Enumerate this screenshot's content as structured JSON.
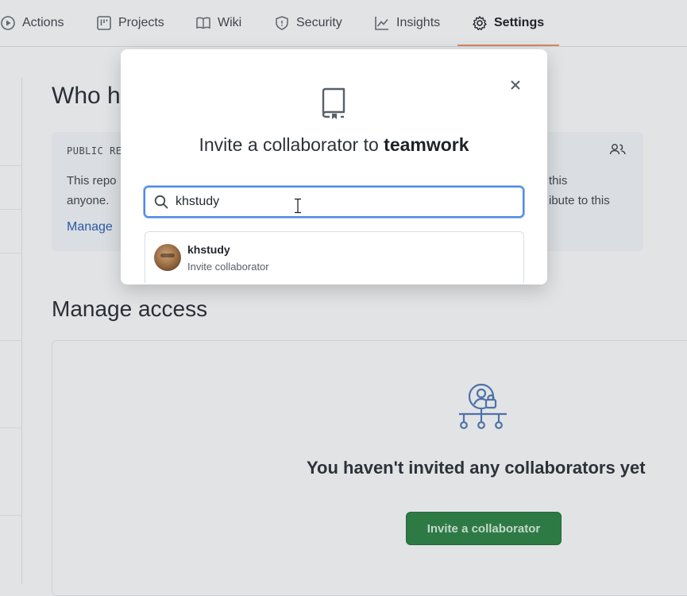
{
  "nav": {
    "tabs": [
      {
        "label": "Actions",
        "icon": "play-circle-icon"
      },
      {
        "label": "Projects",
        "icon": "project-board-icon"
      },
      {
        "label": "Wiki",
        "icon": "book-icon"
      },
      {
        "label": "Security",
        "icon": "shield-icon"
      },
      {
        "label": "Insights",
        "icon": "graph-icon"
      },
      {
        "label": "Settings",
        "icon": "gear-icon",
        "active": true
      }
    ]
  },
  "page": {
    "who_title": "Who h",
    "public_label": "PUBLIC RE",
    "public_desc_left": [
      "This repo",
      "anyone."
    ],
    "public_desc_right": [
      "this",
      "ibute to this"
    ],
    "manage_link": "Manage",
    "manage_title": "Manage access",
    "empty_text": "You haven't invited any collaborators yet",
    "invite_button": "Invite a collaborator"
  },
  "modal": {
    "title_prefix": "Invite a collaborator to ",
    "repo_name": "teamwork",
    "search_value": "khstudy",
    "suggestion": {
      "username": "khstudy",
      "action": "Invite collaborator"
    }
  },
  "colors": {
    "accent_blue": "#4d8ae6",
    "primary_button": "#2d7a45",
    "active_tab_underline": "#d6865f"
  }
}
